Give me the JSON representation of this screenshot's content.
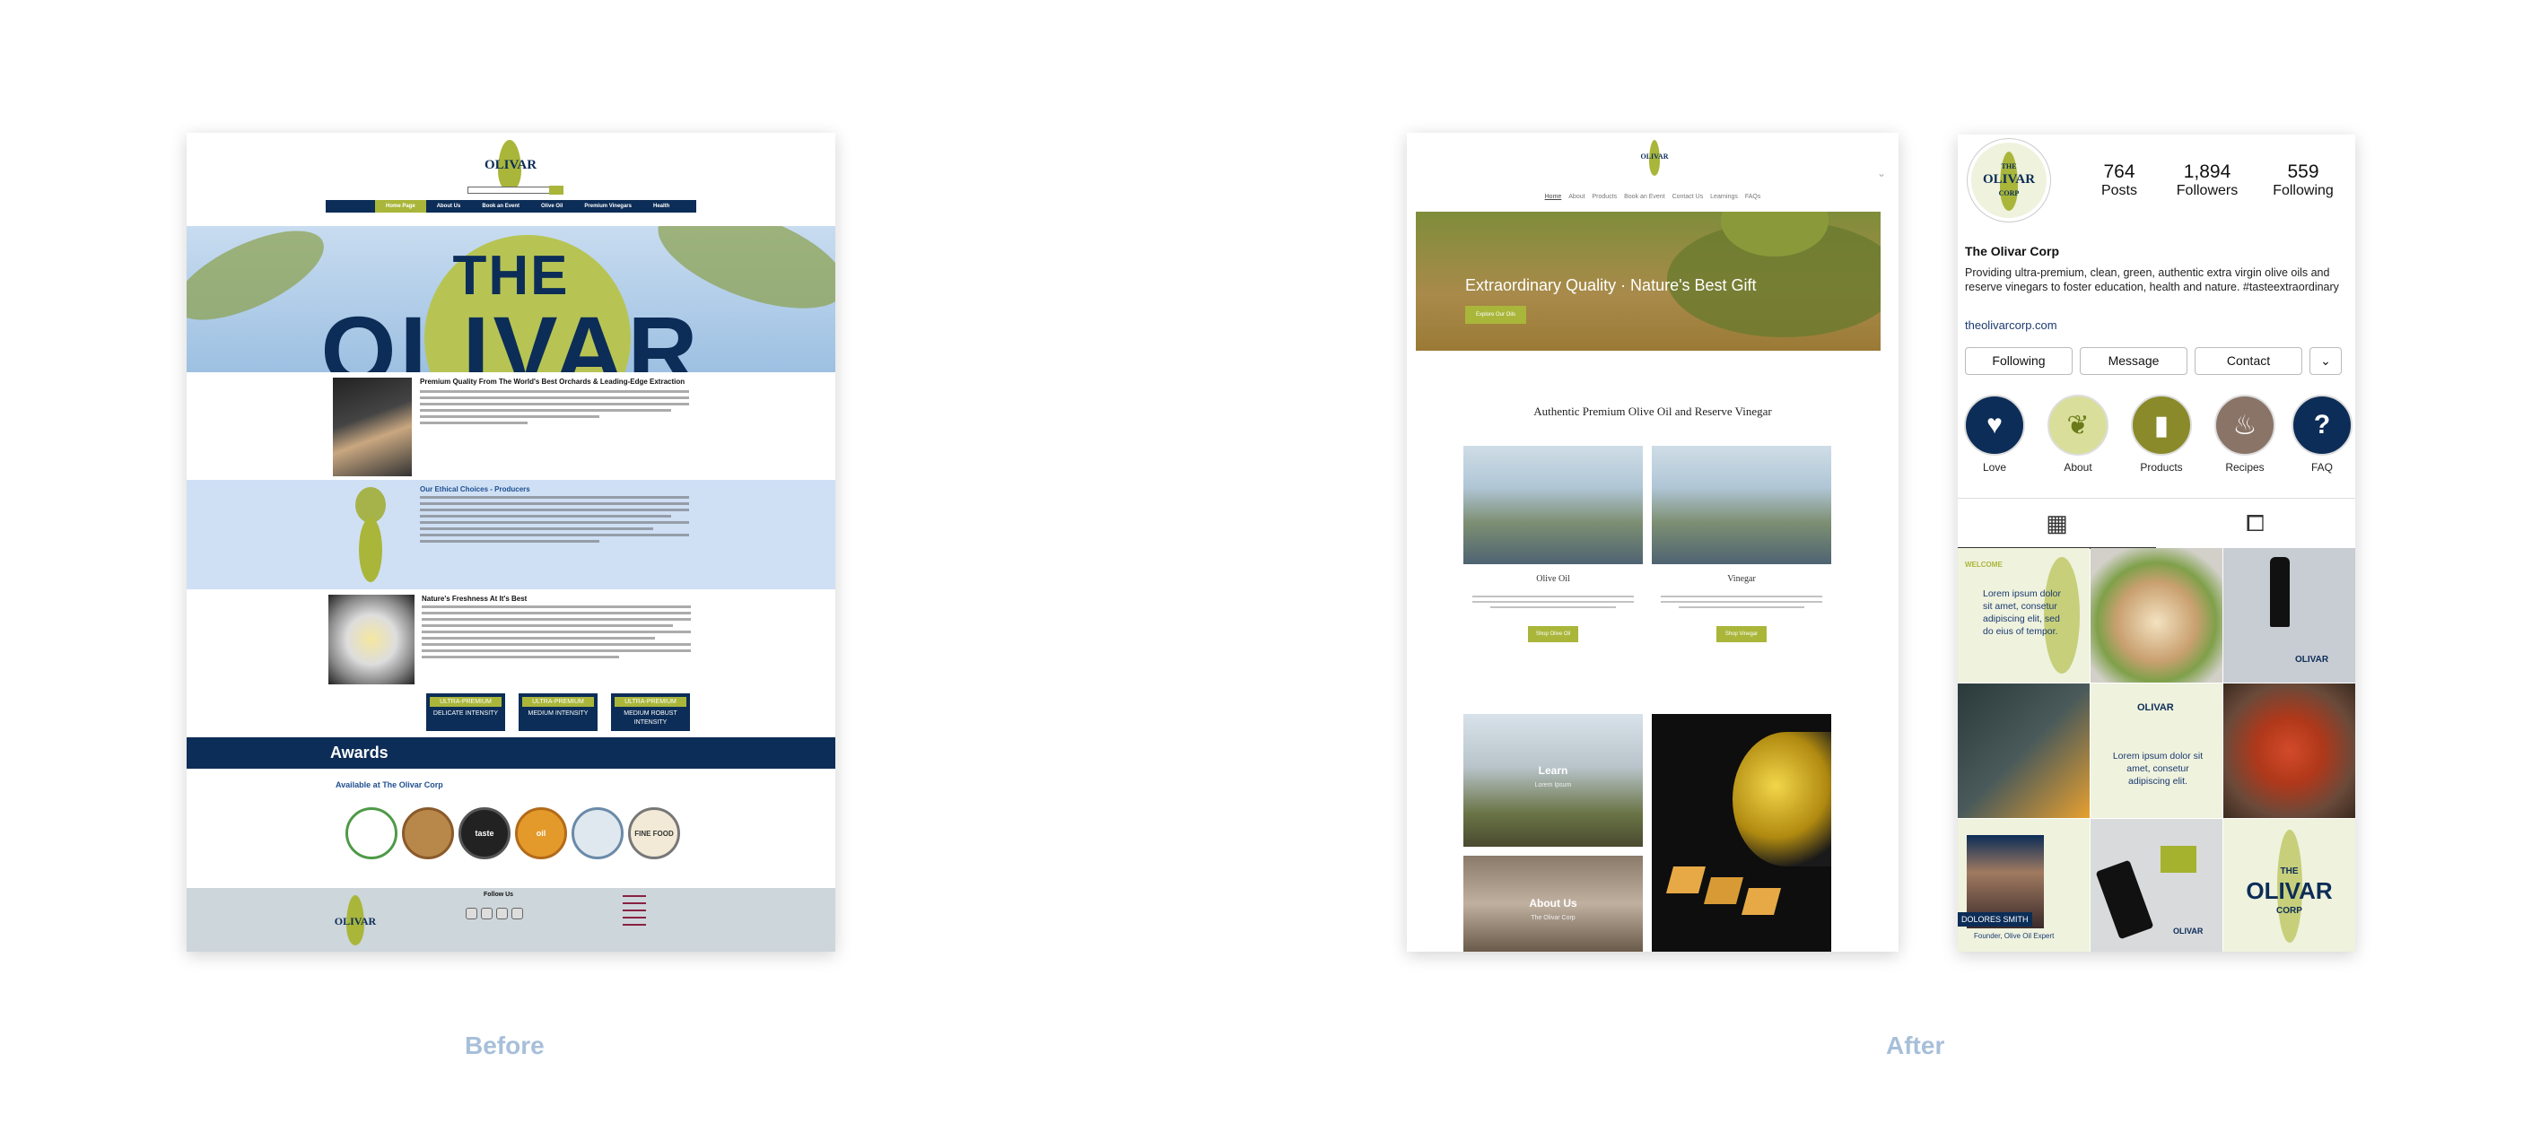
{
  "captions": {
    "before": "Before",
    "after": "After"
  },
  "before": {
    "logo": "OLIVAR",
    "nav": [
      "Home Page",
      "About Us",
      "Book an Event",
      "Olive Oil",
      "Premium Vinegars",
      "Health"
    ],
    "hero": {
      "line1": "THE",
      "line2": "OLIVAR"
    },
    "sections": [
      {
        "heading": "Premium Quality From The World's Best Orchards & Leading-Edge Extraction"
      },
      {
        "heading": "Our Ethical Choices - Producers"
      },
      {
        "heading": "Nature's Freshness At It's Best"
      }
    ],
    "intensity": [
      {
        "top": "ULTRA-PREMIUM",
        "bottom": "DELICATE INTENSITY"
      },
      {
        "top": "ULTRA-PREMIUM",
        "bottom": "MEDIUM INTENSITY"
      },
      {
        "top": "ULTRA-PREMIUM",
        "bottom": "MEDIUM ROBUST INTENSITY"
      }
    ],
    "awards_title": "Awards",
    "available": "Available at The Olivar Corp",
    "medals": [
      "",
      "",
      "taste",
      "oil",
      "",
      "FINE FOOD"
    ],
    "footer": {
      "logo": "OLIVAR",
      "follow": "Follow Us"
    }
  },
  "site": {
    "logo": "OLIVAR",
    "nav": [
      "Home",
      "About",
      "Products",
      "Book an Event",
      "Contact Us",
      "Learnings",
      "FAQs"
    ],
    "hero": {
      "title": "Extraordinary Quality  ·  Nature's Best Gift",
      "button": "Explore Our Oils"
    },
    "heading": "Authentic Premium Olive Oil and Reserve Vinegar",
    "cards": [
      {
        "caption": "Olive Oil",
        "button": "Shop Olive Oil"
      },
      {
        "caption": "Vinegar",
        "button": "Shop Vinegar"
      }
    ],
    "tiles": [
      {
        "title": "Learn",
        "sub": "Lorem Ipsum"
      },
      {
        "title": "About Us",
        "sub": "The Olivar Corp"
      }
    ]
  },
  "insta": {
    "stats": [
      {
        "num": "764",
        "label": "Posts"
      },
      {
        "num": "1,894",
        "label": "Followers"
      },
      {
        "num": "559",
        "label": "Following"
      }
    ],
    "name": "The Olivar Corp",
    "bio": "Providing ultra-premium, clean, green, authentic extra virgin olive oils and reserve vinegars to foster education, health and nature. #tasteextraordinary",
    "link": "theolivarcorp.com",
    "buttons": [
      "Following",
      "Message",
      "Contact",
      "⌄"
    ],
    "highlights": [
      {
        "label": "Love",
        "icon": "heart-icon",
        "glyph": "♥",
        "color": "#0c2d57"
      },
      {
        "label": "About",
        "icon": "olive-branch-icon",
        "glyph": "❦",
        "color": "#d9df9a"
      },
      {
        "label": "Products",
        "icon": "bottle-icon",
        "glyph": "▮",
        "color": "#8a8a2a"
      },
      {
        "label": "Recipes",
        "icon": "chef-hat-icon",
        "glyph": "♨",
        "color": "#8a7468"
      },
      {
        "label": "FAQ",
        "icon": "question-icon",
        "glyph": "?",
        "color": "#0c2d57"
      }
    ],
    "posts": [
      {
        "text": "Lorem ipsum dolor sit amet, consetur adipiscing elit, sed do eius of tempor.",
        "welcome": "WELCOME"
      },
      {
        "text": ""
      },
      {
        "text": "",
        "brand": "OLIVAR"
      },
      {
        "text": ""
      },
      {
        "text": "Lorem ipsum dolor sit amet, consetur adipiscing elit.",
        "brand": "OLIVAR"
      },
      {
        "text": ""
      },
      {
        "text": "",
        "person": "DOLORES SMITH",
        "role": "Founder, Olive Oil Expert"
      },
      {
        "text": "",
        "brand": "OLIVAR"
      },
      {
        "text": "",
        "brand_line1": "THE",
        "brand_line2": "OLIVAR",
        "brand_line3": "CORP"
      }
    ]
  }
}
